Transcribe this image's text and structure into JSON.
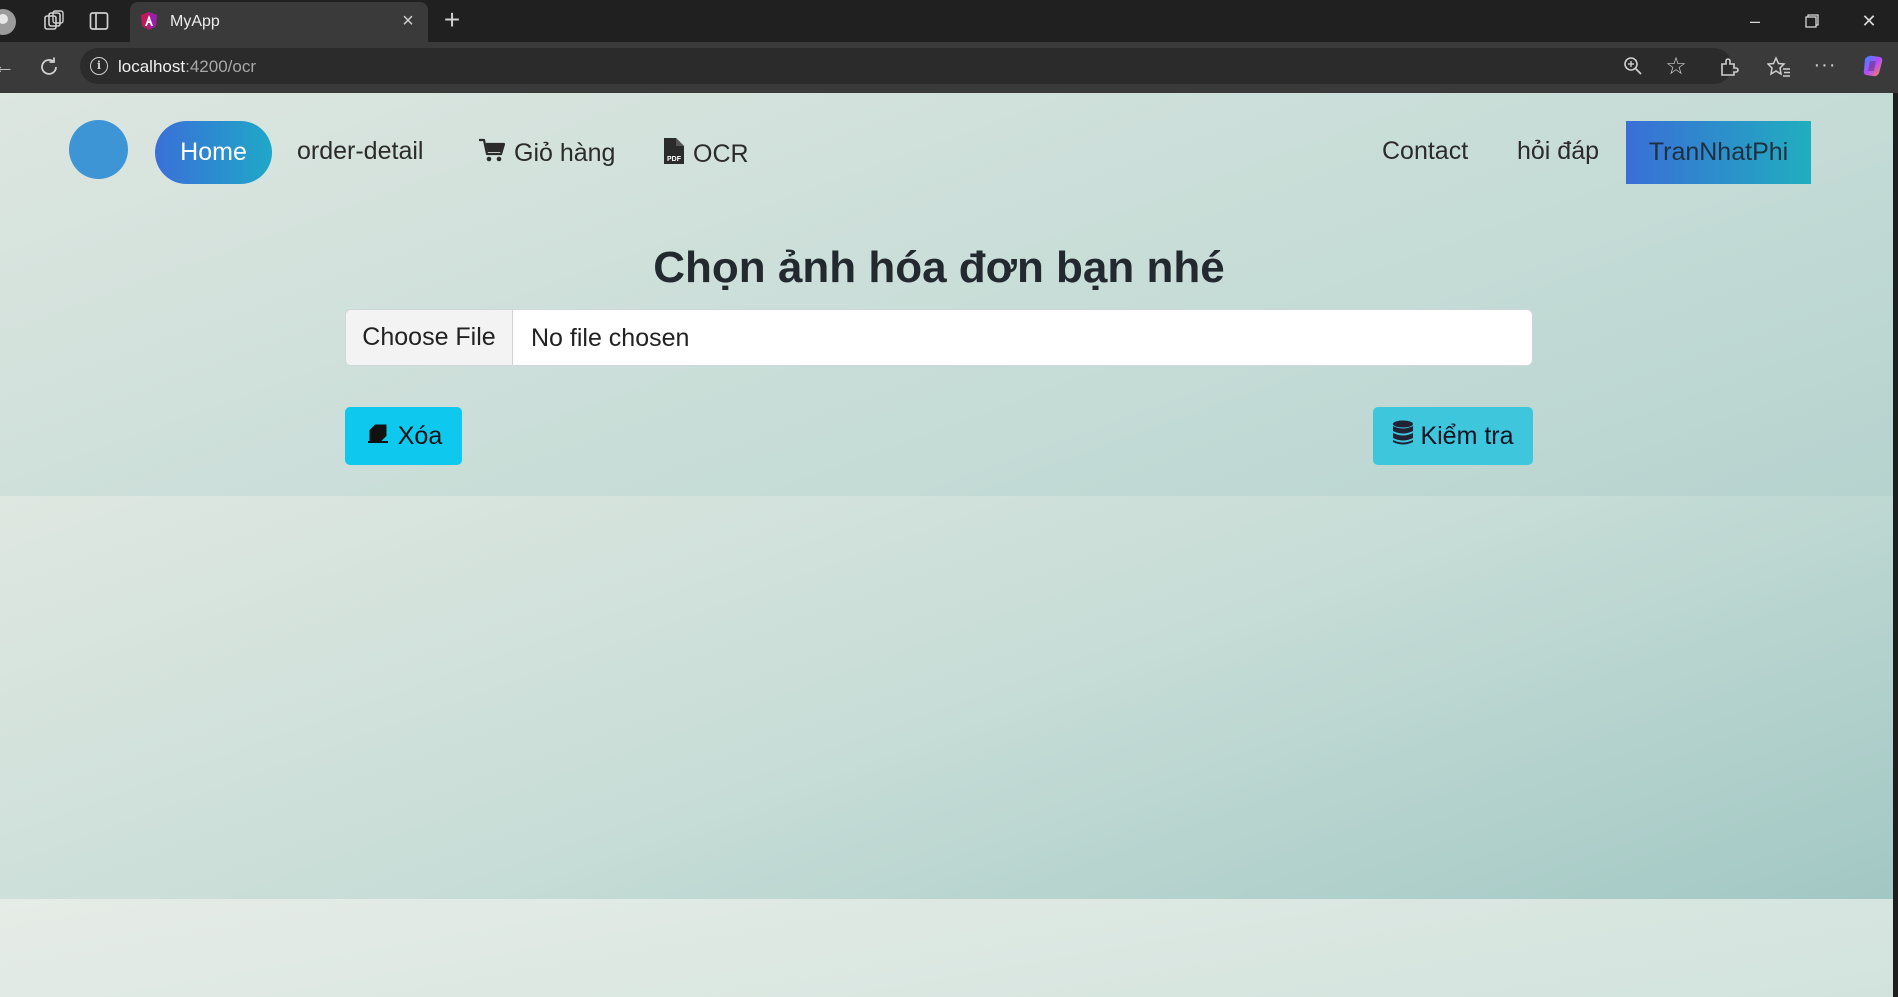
{
  "browser": {
    "tab_title": "MyApp",
    "url_host": "localhost",
    "url_path": ":4200/ocr"
  },
  "nav": {
    "home_label": "Home",
    "order_detail_label": "order-detail",
    "cart_label": "Giỏ hàng",
    "ocr_label": "OCR",
    "contact_label": "Contact",
    "faq_label": "hỏi đáp",
    "user_label": "TranNhatPhi"
  },
  "main": {
    "heading": "Chọn ảnh hóa đơn bạn nhé",
    "file_button_label": "Choose File",
    "file_status": "No file chosen",
    "clear_button_label": "Xóa",
    "check_button_label": "Kiểm tra"
  },
  "colors": {
    "accent_blue": "#3a6fd8",
    "accent_cyan": "#0fc8ee",
    "logo_circle": "#3d95d6"
  },
  "icons": [
    "profile-icon",
    "workspaces-icon",
    "tab-actions-icon",
    "angular-logo-icon",
    "close-icon",
    "new-tab-icon",
    "minimize-icon",
    "restore-icon",
    "back-icon",
    "refresh-icon",
    "site-info-icon",
    "zoom-icon",
    "favorite-star-icon",
    "extensions-icon",
    "favorites-icon",
    "more-icon",
    "copilot-icon",
    "cart-icon",
    "pdf-file-icon",
    "eraser-icon",
    "database-icon"
  ]
}
